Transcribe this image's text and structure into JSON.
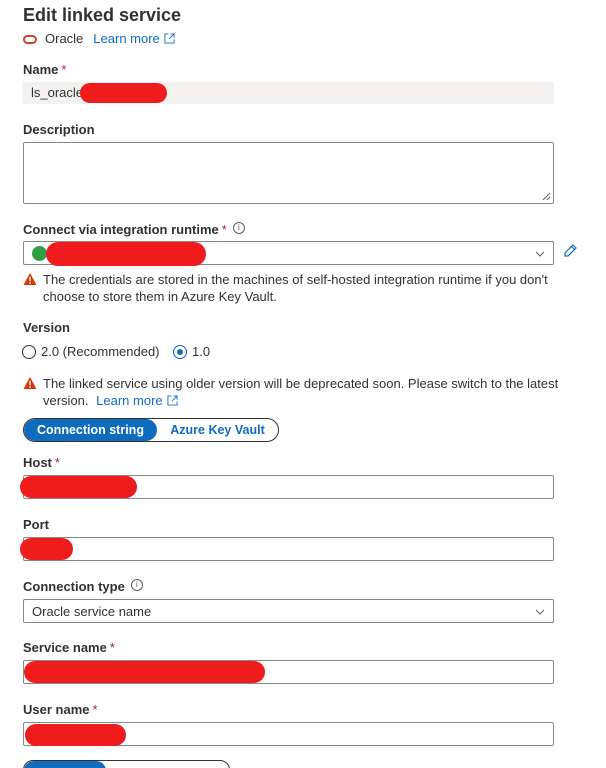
{
  "header": {
    "title": "Edit linked service",
    "service_type": "Oracle",
    "learn_more": "Learn more"
  },
  "name": {
    "label": "Name",
    "required_mark": "*",
    "value": "ls_oracle_"
  },
  "description": {
    "label": "Description",
    "value": ""
  },
  "integration_runtime": {
    "label": "Connect via integration runtime",
    "required_mark": "*",
    "warning": "The credentials are stored in the machines of self-hosted integration runtime if you don't choose to store them in Azure Key Vault."
  },
  "version": {
    "label": "Version",
    "options": [
      "2.0 (Recommended)",
      "1.0"
    ],
    "selected": "1.0",
    "warning": "The linked service using older version will be deprecated soon. Please switch to the latest version.",
    "learn_more": "Learn more"
  },
  "auth_toggle": {
    "options": [
      "Connection string",
      "Azure Key Vault"
    ],
    "selected": "Connection string"
  },
  "host": {
    "label": "Host",
    "required_mark": "*"
  },
  "port": {
    "label": "Port"
  },
  "connection_type": {
    "label": "Connection type",
    "value": "Oracle service name"
  },
  "service_name": {
    "label": "Service name",
    "required_mark": "*"
  },
  "user_name": {
    "label": "User name",
    "required_mark": "*"
  },
  "colors": {
    "accent": "#0f6cbd",
    "warning": "#d83b01",
    "redaction": "#ee1c1c",
    "success": "#2e9e45"
  }
}
